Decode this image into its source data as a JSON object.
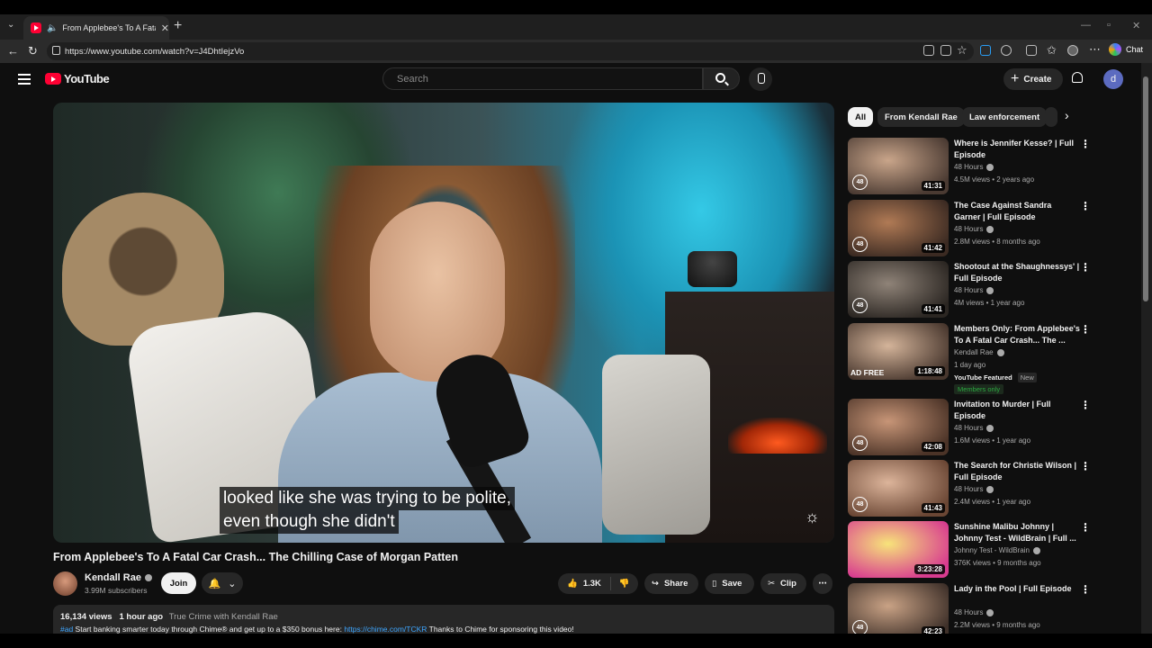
{
  "browser": {
    "tab_title": "From Applebee's To A Fatal C...",
    "tab_close": "✕",
    "new_tab": "+",
    "url": "https://www.youtube.com/watch?v=J4DhtIejzVo",
    "chat_label": "Chat"
  },
  "yt": {
    "logo_text": "YouTube",
    "search_placeholder": "Search",
    "create_label": "Create",
    "avatar_letter": "d"
  },
  "player": {
    "caption_line1": "looked like she was trying to be polite,",
    "caption_line2": "even though she didn't"
  },
  "video": {
    "title": "From Applebee's To A Fatal Car Crash... The Chilling Case of Morgan Patten",
    "channel": "Kendall Rae",
    "subscribers": "3.99M subscribers",
    "join_label": "Join",
    "likes": "1.3K",
    "share_label": "Share",
    "save_label": "Save",
    "clip_label": "Clip",
    "views": "16,134 views",
    "age": "1 hour ago",
    "tag": "True Crime with Kendall Rae",
    "desc_hashtag": "#ad",
    "desc_text": " Start banking smarter today through Chime® and get up to a $350 bonus here: ",
    "desc_link": "https://chime.com/TCKR",
    "desc_tail": " Thanks to Chime for sponsoring this video!"
  },
  "chips": [
    "All",
    "From Kendall Rae",
    "Law enforcement"
  ],
  "recommendations": [
    {
      "title": "Where is Jennifer Kesse? | Full Episode",
      "channel": "48 Hours",
      "meta": "4.5M views • 2 years ago",
      "duration": "41:31",
      "badge": "48",
      "colors": [
        "#c9a58a",
        "#4a3a32"
      ]
    },
    {
      "title": "The Case Against Sandra Garner | Full Episode",
      "channel": "48 Hours",
      "meta": "2.8M views • 8 months ago",
      "duration": "41:42",
      "badge": "48",
      "colors": [
        "#b07a55",
        "#3b2a22"
      ]
    },
    {
      "title": "Shootout at the Shaughnessys' | Full Episode",
      "channel": "48 Hours",
      "meta": "4M views • 1 year ago",
      "duration": "41:41",
      "badge": "48",
      "colors": [
        "#8f8378",
        "#2b2622"
      ]
    },
    {
      "title": "Members Only: From Applebee's To A Fatal Car Crash... The ...",
      "channel": "Kendall Rae",
      "meta": "1 day ago",
      "duration": "1:18:48",
      "adfree": "AD FREE",
      "featured": "YouTube Featured",
      "new": "New",
      "members": "Members only",
      "colors": [
        "#d4b49a",
        "#47362d"
      ]
    },
    {
      "title": "Invitation to Murder | Full Episode",
      "channel": "48 Hours",
      "meta": "1.6M views • 1 year ago",
      "duration": "42:08",
      "badge": "48",
      "colors": [
        "#c79577",
        "#4b3327"
      ]
    },
    {
      "title": "The Search for Christie Wilson | Full Episode",
      "channel": "48 Hours",
      "meta": "2.4M views • 1 year ago",
      "duration": "41:43",
      "badge": "48",
      "colors": [
        "#dcb49a",
        "#6a4634"
      ]
    },
    {
      "title": "Sunshine Malibu Johnny | Johnny Test - WildBrain | Full ...",
      "channel": "Johnny Test - WildBrain",
      "meta": "376K views • 9 months ago",
      "duration": "3:23:28",
      "colors": [
        "#f7e37a",
        "#d83b8f"
      ]
    },
    {
      "title": "Lady in the Pool | Full Episode",
      "channel": "48 Hours",
      "meta": "2.2M views • 9 months ago",
      "duration": "42:23",
      "badge": "48",
      "colors": [
        "#c9a285",
        "#3e3029"
      ]
    }
  ]
}
